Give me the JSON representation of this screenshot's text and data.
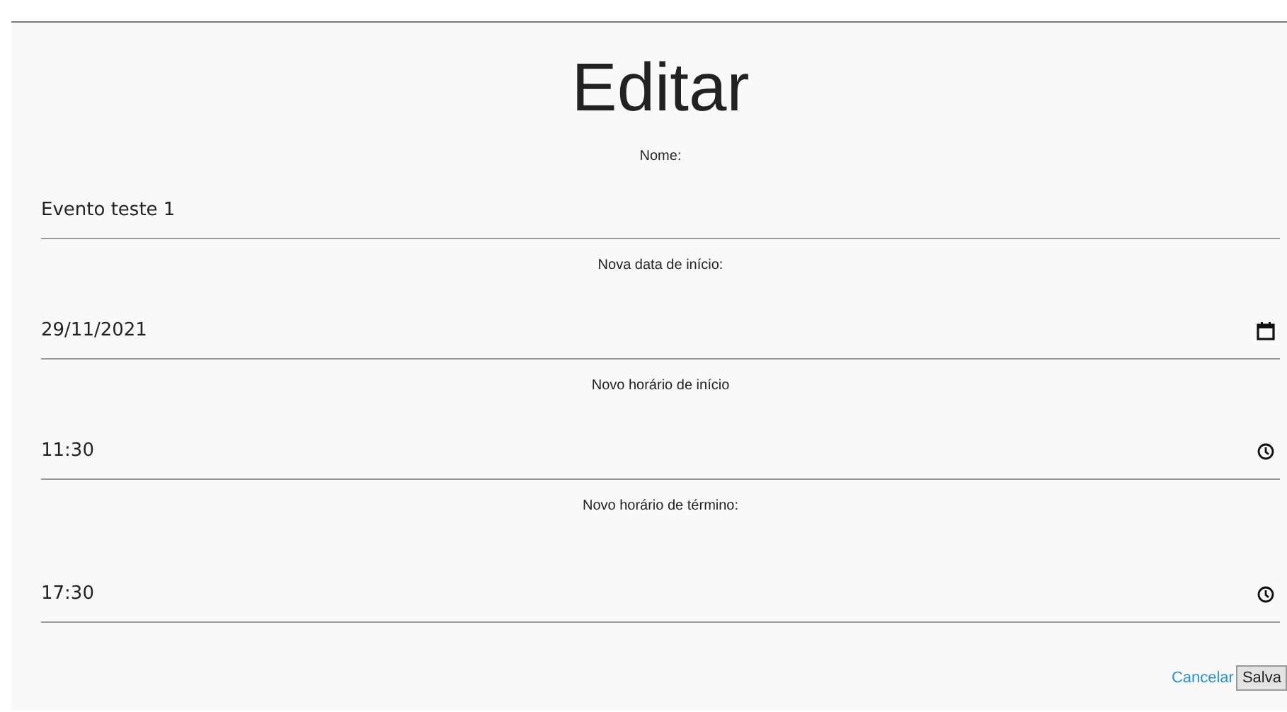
{
  "title": "Editar",
  "fields": [
    {
      "label": "Nome:",
      "kind": "text",
      "value": "Evento teste 1"
    },
    {
      "label": "Nova data de início:",
      "kind": "date",
      "value": "29/11/2021"
    },
    {
      "label": "Novo horário de início",
      "kind": "time",
      "value": "11:30"
    },
    {
      "label": "Novo horário de término:",
      "kind": "time",
      "value": "17:30"
    }
  ],
  "cancel_link": "Cancelar",
  "save_button": "Salva"
}
